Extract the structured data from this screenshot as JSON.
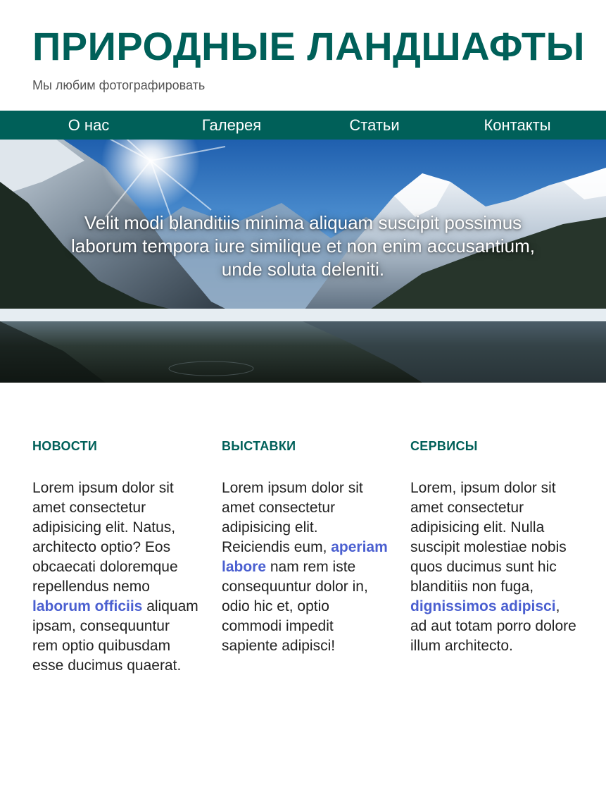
{
  "header": {
    "title": "ПРИРОДНЫЕ ЛАНДШАФТЫ",
    "tagline": "Мы любим фотографировать"
  },
  "nav": {
    "items": [
      {
        "label": "О нас"
      },
      {
        "label": "Галерея"
      },
      {
        "label": "Статьи"
      },
      {
        "label": "Контакты"
      }
    ]
  },
  "hero": {
    "text": "Velit modi blanditiis minima aliquam suscipit possimus laborum tempora iure similique et non enim accusantium, unde soluta deleniti.",
    "image": "mountain-lake-photo"
  },
  "columns": [
    {
      "heading": "НОВОСТИ",
      "text_before": "Lorem ipsum dolor sit amet consectetur adipisicing elit. Natus, architecto optio? Eos obcaecati doloremque repellendus nemo ",
      "link": "laborum officiis",
      "text_after": " aliquam ipsam, consequuntur rem optio quibusdam esse ducimus quaerat."
    },
    {
      "heading": "ВЫСТАВКИ",
      "text_before": "Lorem ipsum dolor sit amet consectetur adipisicing elit. Reiciendis eum, ",
      "link": "aperiam labore",
      "text_after": " nam rem iste consequuntur dolor in, odio hic et, optio commodi impedit sapiente adipisci!"
    },
    {
      "heading": "СЕРВИСЫ",
      "text_before": "Lorem, ipsum dolor sit amet consectetur adipisicing elit. Nulla suscipit molestiae nobis quos ducimus sunt hic blanditiis non fuga, ",
      "link": "dignissimos adipisci",
      "text_after": ", ad aut totam porro dolore illum architecto."
    }
  ],
  "colors": {
    "brand": "#006059",
    "link": "#4a5fd0",
    "text": "#222222",
    "muted": "#555555"
  }
}
